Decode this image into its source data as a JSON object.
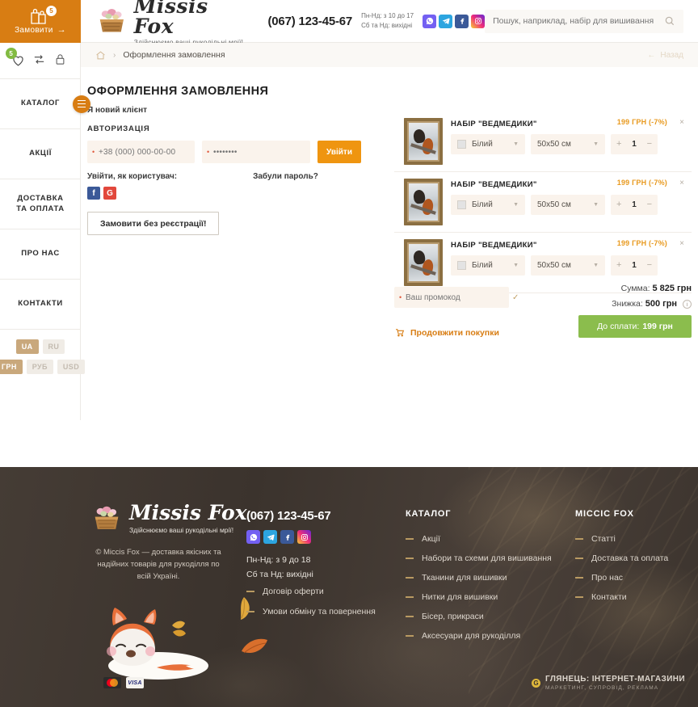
{
  "rail": {
    "order_button": {
      "label": "Замовити",
      "badge": "5",
      "arrow": "→",
      "icon": "shopping-bags-icon"
    },
    "icons": [
      {
        "name": "heart-icon",
        "badge": "5"
      },
      {
        "name": "compare-icon",
        "badge": ""
      },
      {
        "name": "lock-icon",
        "badge": ""
      }
    ],
    "nav": [
      {
        "label": "Каталог"
      },
      {
        "label": "Акції"
      },
      {
        "label": "Доставка\nта оплата"
      },
      {
        "label": "Про нас"
      },
      {
        "label": "Контакти"
      }
    ],
    "nav_labels": {
      "catalog": "КАТАЛОГ",
      "promos": "АКЦІЇ",
      "delivery_l1": "ДОСТАВКА",
      "delivery_l2": "ТА ОПЛАТА",
      "about": "ПРО НАС",
      "contacts": "КОНТАКТИ"
    },
    "languages": [
      {
        "code": "UA",
        "active": true
      },
      {
        "code": "RU",
        "active": false
      }
    ],
    "currencies": [
      {
        "code": "ГРН",
        "active": true
      },
      {
        "code": "РУБ",
        "active": false
      },
      {
        "code": "USD",
        "active": false
      }
    ]
  },
  "header": {
    "logo_name": "Missis Fox",
    "logo_tagline": "Здійснюємо ваші рукодільні мрії!",
    "phone": "(067) 123-45-67",
    "hours_line1": "Пн-Нд: з 10 до 17",
    "hours_line2": "Сб та Нд: вихідні",
    "socials": [
      "viber-icon",
      "telegram-icon",
      "facebook-icon",
      "instagram-icon"
    ],
    "search": {
      "placeholder": "Пошук, наприклад, набір для вишивання",
      "value": "",
      "icon": "search-icon"
    }
  },
  "breadcrumb": {
    "home_icon": "home-icon",
    "separator": "›",
    "current": "Оформлення замовлення",
    "back_label": "Назад",
    "back_arrow": "←"
  },
  "checkout": {
    "title": "ОФОРМЛЕННЯ ЗАМОВЛЕННЯ",
    "new_client": "Я новий клієнт",
    "auth_title": "АВТОРИЗАЦІЯ",
    "phone_placeholder": "+38 (000) 000-00-00",
    "phone_value": "",
    "password_placeholder": "••••••••",
    "password_value": "",
    "login_button": "Увійти",
    "login_as": "Увійти, як користувач:",
    "forgot_password": "Забули пароль?",
    "oauth": [
      {
        "name": "facebook-login",
        "glyph": "f"
      },
      {
        "name": "google-login",
        "glyph": "G"
      }
    ],
    "guest_button": "Замовити без реєстрації!"
  },
  "cart": {
    "items": [
      {
        "name": "НАБІР \"ВЕДМЕДИКИ\"",
        "price": "199 ГРН (-7%)",
        "color": "Білий",
        "size": "50x50 см",
        "qty": "1",
        "remove": "×",
        "plus": "+",
        "minus": "−"
      },
      {
        "name": "НАБІР \"ВЕДМЕДИКИ\"",
        "price": "199 ГРН (-7%)",
        "color": "Білий",
        "size": "50x50 см",
        "qty": "1",
        "remove": "×",
        "plus": "+",
        "minus": "−"
      },
      {
        "name": "НАБІР \"ВЕДМЕДИКИ\"",
        "price": "199 ГРН (-7%)",
        "color": "Білий",
        "size": "50x50 см",
        "qty": "1",
        "remove": "×",
        "plus": "+",
        "minus": "−"
      }
    ]
  },
  "summary": {
    "promo_placeholder": "Ваш промокод",
    "promo_value": "",
    "promo_apply_icon": "check-icon",
    "continue_label": "Продовжити покупки",
    "continue_icon": "cart-icon",
    "sum_label": "Сумма:",
    "sum_value": "5 825 грн",
    "discount_label": "Знижка:",
    "discount_value": "500 грн",
    "discount_info": "i",
    "pay_label": "До сплати:",
    "pay_value": "199 грн"
  },
  "footer": {
    "logo_name": "Missis Fox",
    "logo_tagline": "Здійснюємо ваші рукодільні мрії!",
    "copyright": "© Miccis Fox — доставка якісних та надійних товарів для рукоділля по всій Україні.",
    "phone": "(067) 123-45-67",
    "socials": [
      "viber-icon",
      "telegram-icon",
      "facebook-icon",
      "instagram-icon"
    ],
    "hours_line1": "Пн-Нд: з 9 до 18",
    "hours_line2": "Сб та Нд: вихідні",
    "legal_links": [
      {
        "label": "Договір оферти"
      },
      {
        "label": "Умови обміну та повернення"
      }
    ],
    "catalog_title": "КАТАЛОГ",
    "catalog_links": [
      {
        "label": "Акції"
      },
      {
        "label": "Набори та схеми для вишивання"
      },
      {
        "label": "Тканини для вишивки"
      },
      {
        "label": "Нитки для вишивки"
      },
      {
        "label": "Бісер, прикраси"
      },
      {
        "label": "Аксесуари для рукоділля"
      }
    ],
    "about_title": "MICCIC FOX",
    "about_links": [
      {
        "label": "Статті"
      },
      {
        "label": "Доставка та оплата"
      },
      {
        "label": "Про нас"
      },
      {
        "label": "Контакти"
      }
    ],
    "cards": [
      "mastercard-icon",
      "visa-icon"
    ],
    "visa_text": "VISA",
    "agency_name": "ГЛЯНЕЦЬ: ІНТЕРНЕТ-МАГАЗИНИ",
    "agency_sub": "МАРКЕТИНГ, СУПРОВІД, РЕКЛАМА"
  },
  "colors": {
    "brand_orange": "#d87d13",
    "accent_orange": "#ef9510",
    "price_orange": "#e89a20",
    "green": "#8bbd4d",
    "footer_bg": "#3a332e",
    "field_bg": "#faf3ec"
  }
}
